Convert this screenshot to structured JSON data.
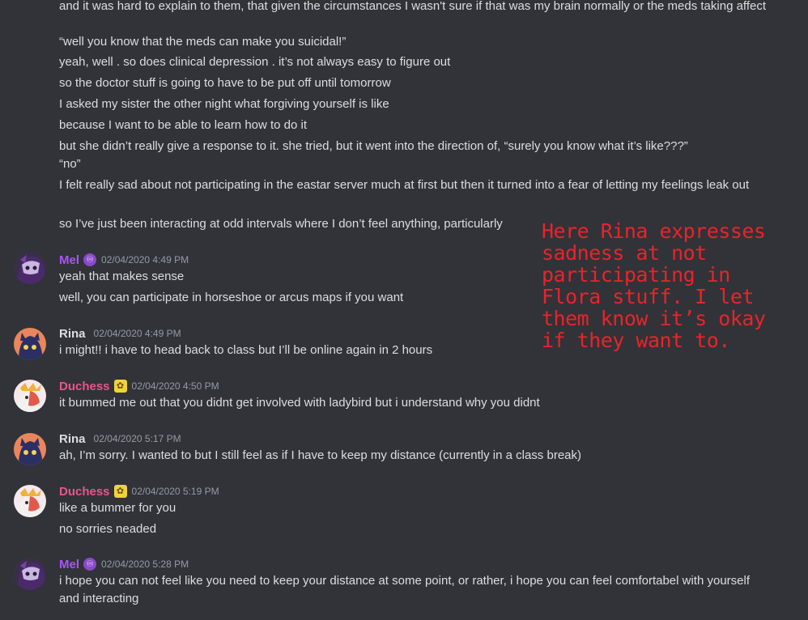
{
  "earlier_lines": [
    "and it was hard to explain to them, that given the circumstances I wasn't sure if that was my brain normally or the meds taking affect",
    "“well you know that the meds can make you suicidal!”",
    "yeah, well . so does clinical depression . it’s not always easy to figure out",
    "so the doctor stuff is going to have to be put off until tomorrow",
    "I asked my sister the other night what forgiving yourself is like",
    "because I want to be able to learn how to do it",
    "but she didn’t really give a response to it. she tried, but it went into the direction of, “surely you know what it’s like???”",
    "“no”",
    "I felt really sad about not participating in the eastar server much at first but then it turned into a fear of letting my feelings leak out",
    "so I’ve just been interacting at odd intervals where I don’t feel anything, particularly"
  ],
  "messages": [
    {
      "author": "Mel",
      "author_color": "#a855f7",
      "badge_icon": "purple-emblem-icon",
      "badge_glyph": "♾",
      "timestamp": "02/04/2020 4:49 PM",
      "lines": [
        "yeah that makes sense",
        "well, you can participate in horseshoe or arcus maps if you want"
      ]
    },
    {
      "author": "Rina",
      "author_color": "#dbdee1",
      "badge_icon": "",
      "badge_glyph": "",
      "timestamp": "02/04/2020 4:49 PM",
      "lines": [
        "i might!! i have to head back to class but I’ll be online again in 2 hours"
      ]
    },
    {
      "author": "Duchess",
      "author_color": "#e9568c",
      "badge_icon": "yellow-emblem-icon",
      "badge_glyph": "✿",
      "timestamp": "02/04/2020 4:50 PM",
      "lines": [
        "it bummed me out that you didnt get involved with ladybird but i understand why you didnt"
      ]
    },
    {
      "author": "Rina",
      "author_color": "#dbdee1",
      "badge_icon": "",
      "badge_glyph": "",
      "timestamp": "02/04/2020 5:17 PM",
      "lines": [
        "ah, I’m sorry. I wanted to but I still feel as if I have to keep my distance (currently in a class break)"
      ]
    },
    {
      "author": "Duchess",
      "author_color": "#e9568c",
      "badge_icon": "yellow-emblem-icon",
      "badge_glyph": "✿",
      "timestamp": "02/04/2020 5:19 PM",
      "lines": [
        "like a bummer for you",
        "no sorries neaded"
      ]
    },
    {
      "author": "Mel",
      "author_color": "#a855f7",
      "badge_icon": "purple-emblem-icon",
      "badge_glyph": "♾",
      "timestamp": "02/04/2020 5:28 PM",
      "lines": [
        "i hope you can not feel like you need to keep your distance at some point, or rather, i hope you can feel comfortabel with yourself and interacting"
      ]
    }
  ],
  "annotation": "Here Rina expresses sadness at not participating in Flora stuff. I let them know it’s okay if they want to.",
  "colors": {
    "background": "#313338",
    "text": "#dbdee1",
    "timestamp": "#949ba4",
    "annotation": "#e8242a"
  }
}
